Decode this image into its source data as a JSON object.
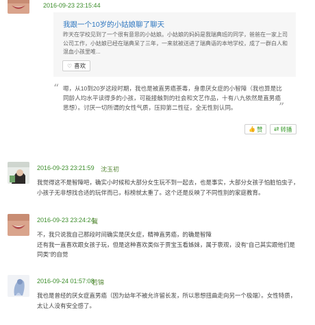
{
  "post": {
    "timestamp": "2016-09-23 23:15:44",
    "share": {
      "title": "我跟一个10岁的小姑娘聊了聊天",
      "summary": "昨天在学校见到了一个很有意思的小姑娘。小姑娘的妈妈是我瑞典班的同学，爸爸在一家上司公司工作，小姑娘已经在瑞典呆了三年，一来就被送进了瑞典语的本地学校，成了一群白人和混血小孩里唯...",
      "like_label": "喜欢"
    },
    "quote_text": "嗯，从10到20岁这段时期，我也是被直男癌荼毒，身患厌女症的小智障（我也算是比同龄人均水平读得多的小孩，可能接触到的社会和文艺作品，十有八九依然是直男癌思想）。讨厌一切所谓的女性气质，压抑第二性征，全无性别认同。",
    "actions": {
      "like": "赞",
      "repost": "转播"
    }
  },
  "comments": [
    {
      "timestamp": "2016-09-23 23:21:59",
      "username": "沈玉初",
      "text": "我觉得这不是智障吧，确实小时候和大部分女生玩不到一起去，也是事实，大部分女孩子怕脏怕虫子，小孩子无非想找合适的玩伴而已，标榜就太重了。这个还是反映了不同性别的家庭教育。"
    },
    {
      "timestamp": "2016-09-23 23:24:24",
      "username": "冀",
      "text": "不，我只说我自己那段时间确实是厌女症，精神直男癌，的确是智障\n还有我一直喜欢跟女孩子玩，但是这种喜欢类似于贾宝玉看姊妹，属于亵观，没有“自己其实跟他们是同类”的自觉"
    },
    {
      "timestamp": "2016-09-24 01:57:08",
      "username": "若锦",
      "text": "我也是曾经的厌女症直男癌（因为幼年不被允许留长发，所以思想扭曲走向另一个极端）。女性特质，太让人没有安全感了。"
    }
  ],
  "colors": {
    "timestamp_green": "#3b8d2a",
    "link_blue": "#2f77c0",
    "action_green": "#3c9b2f",
    "card_bg": "#f6f6f6"
  }
}
